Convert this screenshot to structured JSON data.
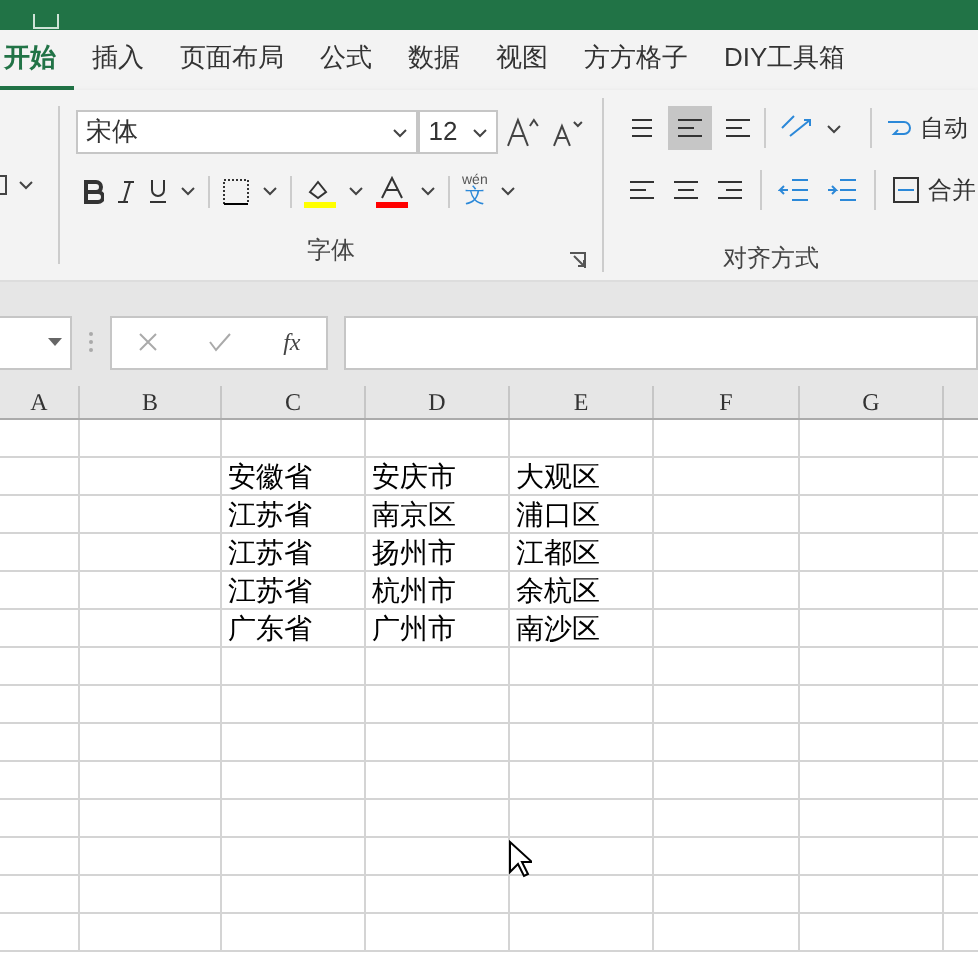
{
  "tabs": [
    {
      "label": "开始",
      "selected": true
    },
    {
      "label": "插入",
      "selected": false
    },
    {
      "label": "页面布局",
      "selected": false
    },
    {
      "label": "公式",
      "selected": false
    },
    {
      "label": "数据",
      "selected": false
    },
    {
      "label": "视图",
      "selected": false
    },
    {
      "label": "方方格子",
      "selected": false
    },
    {
      "label": "DIY工具箱",
      "selected": false
    }
  ],
  "font_group": {
    "font_name": "宋体",
    "font_size": "12",
    "phonetic_top": "wén",
    "phonetic_bottom": "文",
    "label": "字体"
  },
  "alignment_group": {
    "wrap_text": "自动",
    "merge": "合并",
    "label": "对齐方式"
  },
  "formula_bar": {
    "fx": "fx"
  },
  "sheet": {
    "columns": [
      "A",
      "B",
      "C",
      "D",
      "E",
      "F",
      "G"
    ],
    "rows": [
      [
        "",
        "",
        "",
        "",
        "",
        "",
        ""
      ],
      [
        "",
        "",
        "安徽省",
        "安庆市",
        "大观区",
        "",
        ""
      ],
      [
        "",
        "",
        "江苏省",
        "南京区",
        "浦口区",
        "",
        ""
      ],
      [
        "",
        "",
        "江苏省",
        "扬州市",
        "江都区",
        "",
        ""
      ],
      [
        "",
        "",
        "江苏省",
        "杭州市",
        "余杭区",
        "",
        ""
      ],
      [
        "",
        "",
        "广东省",
        "广州市",
        "南沙区",
        "",
        ""
      ],
      [
        "",
        "",
        "",
        "",
        "",
        "",
        ""
      ],
      [
        "",
        "",
        "",
        "",
        "",
        "",
        ""
      ],
      [
        "",
        "",
        "",
        "",
        "",
        "",
        ""
      ],
      [
        "",
        "",
        "",
        "",
        "",
        "",
        ""
      ],
      [
        "",
        "",
        "",
        "",
        "",
        "",
        ""
      ],
      [
        "",
        "",
        "",
        "",
        "",
        "",
        ""
      ],
      [
        "",
        "",
        "",
        "",
        "",
        "",
        ""
      ],
      [
        "",
        "",
        "",
        "",
        "",
        "",
        ""
      ]
    ]
  }
}
